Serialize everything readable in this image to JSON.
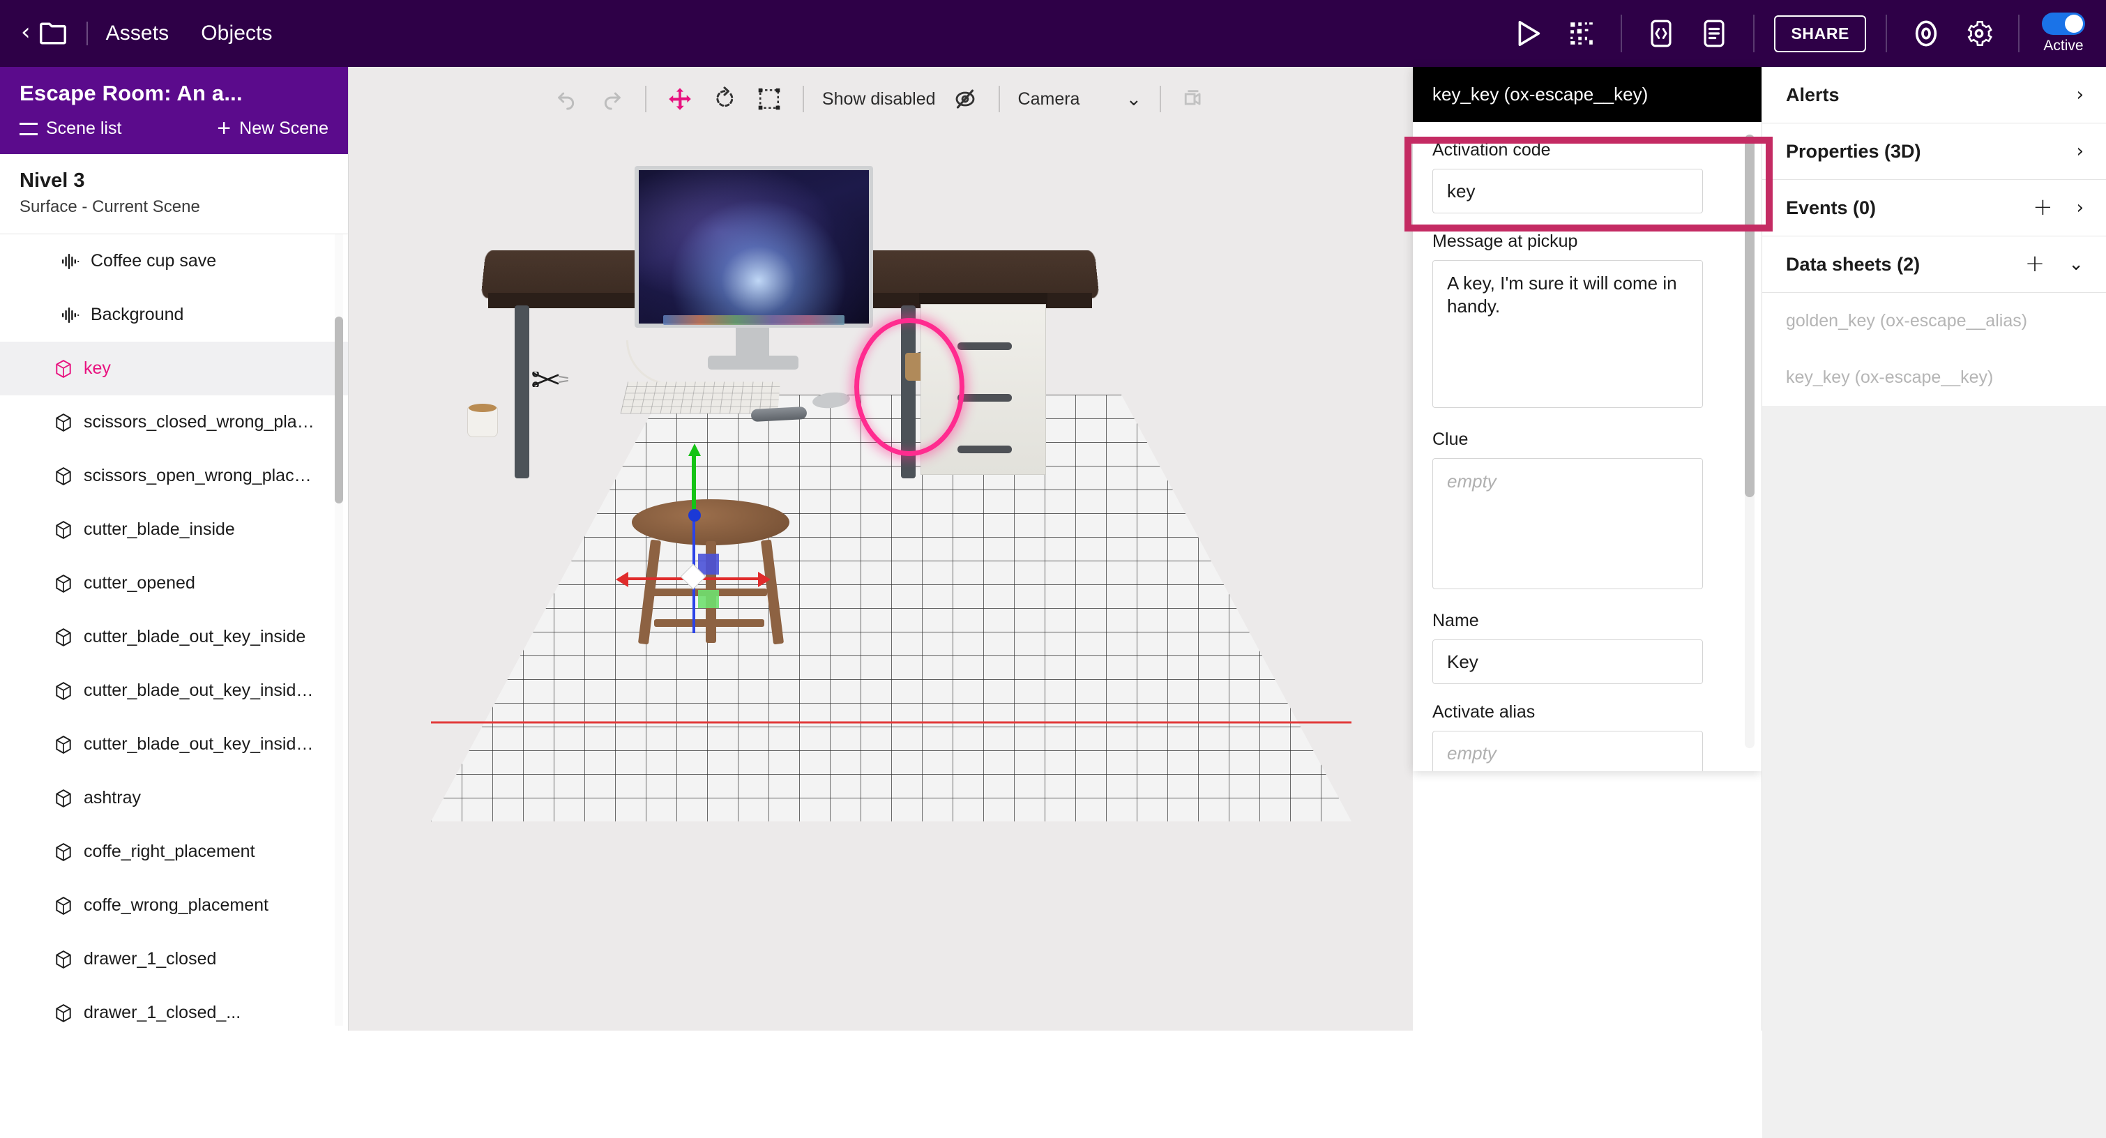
{
  "topbar": {
    "back_icon": "chevron-left-icon",
    "folder_icon": "folder-icon",
    "nav": [
      {
        "label": "Assets",
        "name": "nav-assets"
      },
      {
        "label": "Objects",
        "name": "nav-objects"
      }
    ],
    "actions": {
      "play_icon": "play-icon",
      "qr_icon": "qr-code-icon",
      "code_icon": "code-brackets-icon",
      "doc_icon": "document-icon",
      "share_label": "SHARE",
      "help_icon": "lifebuoy-icon",
      "settings_icon": "gear-icon",
      "toggle_label": "Active",
      "toggle_on": true,
      "toggle_color": "#1a73e8"
    }
  },
  "sidebar": {
    "project_title": "Escape Room: An a...",
    "scene_list_label": "Scene list",
    "new_scene_label": "New Scene",
    "scene_name": "Nivel 3",
    "scene_subtitle": "Surface - Current Scene",
    "objects": [
      {
        "label": "Coffee cup save",
        "icon": "audio-waveform-icon",
        "selected": false,
        "indented": true
      },
      {
        "label": "Background",
        "icon": "audio-waveform-icon",
        "selected": false,
        "indented": true
      },
      {
        "label": "key",
        "icon": "cube-icon",
        "selected": true,
        "indented": false
      },
      {
        "label": "scissors_closed_wrong_place...",
        "icon": "cube-icon",
        "selected": false,
        "indented": false
      },
      {
        "label": "scissors_open_wrong_placem...",
        "icon": "cube-icon",
        "selected": false,
        "indented": false
      },
      {
        "label": "cutter_blade_inside",
        "icon": "cube-icon",
        "selected": false,
        "indented": false
      },
      {
        "label": "cutter_opened",
        "icon": "cube-icon",
        "selected": false,
        "indented": false
      },
      {
        "label": "cutter_blade_out_key_inside",
        "icon": "cube-icon",
        "selected": false,
        "indented": false
      },
      {
        "label": "cutter_blade_out_key_inside_...",
        "icon": "cube-icon",
        "selected": false,
        "indented": false
      },
      {
        "label": "cutter_blade_out_key_inside_...",
        "icon": "cube-icon",
        "selected": false,
        "indented": false
      },
      {
        "label": "ashtray",
        "icon": "cube-icon",
        "selected": false,
        "indented": false
      },
      {
        "label": "coffe_right_placement",
        "icon": "cube-icon",
        "selected": false,
        "indented": false
      },
      {
        "label": "coffe_wrong_placement",
        "icon": "cube-icon",
        "selected": false,
        "indented": false
      },
      {
        "label": "drawer_1_closed",
        "icon": "cube-icon",
        "selected": false,
        "indented": false
      },
      {
        "label": "drawer_1_closed_...",
        "icon": "cube-icon",
        "selected": false,
        "indented": false
      }
    ],
    "selected_color": "#e8117f"
  },
  "viewport": {
    "toolbar": {
      "undo_icon": "undo-icon",
      "redo_icon": "redo-icon",
      "move_icon": "move-tool-icon",
      "rotate_icon": "rotate-tool-icon",
      "scale_icon": "scale-tool-icon",
      "show_disabled_label": "Show disabled",
      "eye_off_icon": "eye-off-icon",
      "camera_label": "Camera",
      "chevron_down_icon": "chevron-down-icon",
      "camera_copy_icon": "camera-icon",
      "active_tool_color": "#e8117f"
    },
    "highlight_color": "#ff2b8f"
  },
  "properties": {
    "header": "key_key (ox-escape__key)",
    "fields": [
      {
        "label": "Activation code",
        "value": "key",
        "type": "input",
        "highlighted": true
      },
      {
        "label": "Message at pickup",
        "value": "A key, I'm sure it will come in handy.",
        "type": "textarea"
      },
      {
        "label": "Clue",
        "value": "",
        "placeholder": "empty",
        "type": "textarea"
      },
      {
        "label": "Name",
        "value": "Key",
        "type": "input"
      },
      {
        "label": "Activate alias",
        "value": "",
        "placeholder": "empty",
        "type": "input"
      }
    ],
    "highlight_color": "#c42b63"
  },
  "rightpanel": {
    "sections": [
      {
        "title": "Alerts",
        "has_plus": false,
        "chevron": "›"
      },
      {
        "title": "Properties (3D)",
        "has_plus": false,
        "chevron": "›"
      },
      {
        "title": "Events (0)",
        "has_plus": true,
        "chevron": "›"
      },
      {
        "title": "Data sheets (2)",
        "has_plus": true,
        "chevron": "⌄"
      }
    ],
    "data_sheets": [
      {
        "label": "golden_key (ox-escape__alias)"
      },
      {
        "label": "key_key (ox-escape__key)"
      }
    ]
  }
}
